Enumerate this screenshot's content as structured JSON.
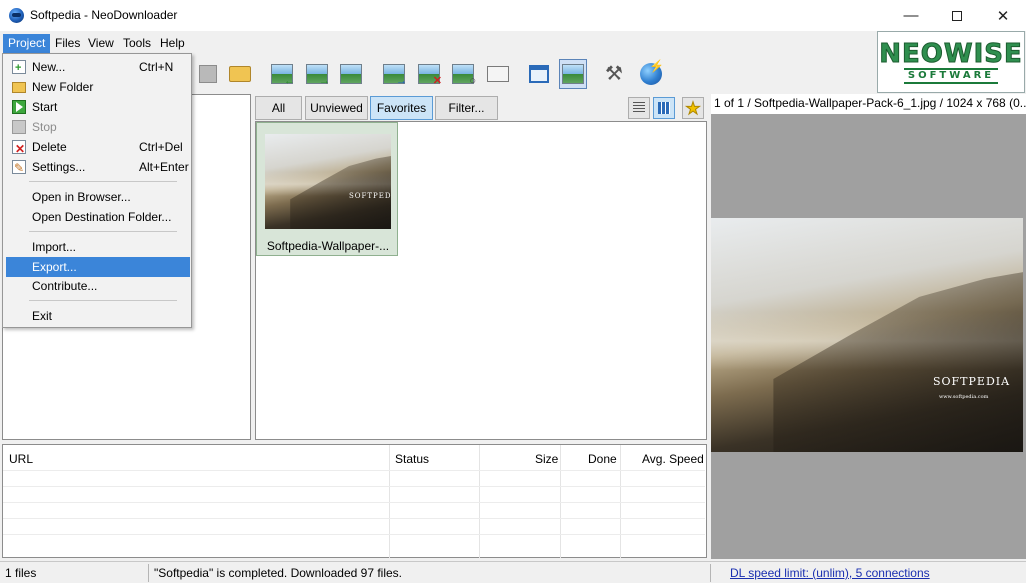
{
  "window": {
    "title": "Softpedia - NeoDownloader"
  },
  "menubar": {
    "items": [
      "Project",
      "Files",
      "View",
      "Tools",
      "Help"
    ]
  },
  "project_menu": {
    "items": [
      {
        "label": "New...",
        "shortcut": "Ctrl+N",
        "icon": "new-project-icon"
      },
      {
        "label": "New Folder",
        "shortcut": "",
        "icon": "folder-icon"
      },
      {
        "label": "Start",
        "shortcut": "",
        "icon": "start-icon"
      },
      {
        "label": "Stop",
        "shortcut": "",
        "icon": "stop-icon",
        "disabled": true
      },
      {
        "label": "Delete",
        "shortcut": "Ctrl+Del",
        "icon": "delete-icon"
      },
      {
        "label": "Settings...",
        "shortcut": "Alt+Enter",
        "icon": "settings-icon"
      },
      {
        "label": "Open in Browser..."
      },
      {
        "label": "Open Destination Folder..."
      },
      {
        "label": "Import..."
      },
      {
        "label": "Export...",
        "highlighted": true
      },
      {
        "label": "Contribute..."
      },
      {
        "label": "Exit"
      }
    ]
  },
  "logo": {
    "main": "NEOWISE",
    "sub": "SOFTWARE"
  },
  "filters": {
    "all": "All",
    "unviewed": "Unviewed",
    "favorites": "Favorites",
    "filter": "Filter..."
  },
  "thumbnail": {
    "label": "Softpedia-Wallpaper-...",
    "watermark": "SOFTPEDIA"
  },
  "preview": {
    "header": "1 of 1 / Softpedia-Wallpaper-Pack-6_1.jpg / 1024 x 768 (0....",
    "watermark": "SOFTPEDIA",
    "sub_watermark": "www.softpedia.com"
  },
  "transfers": {
    "columns": [
      "URL",
      "Status",
      "Size",
      "Done",
      "Avg. Speed"
    ]
  },
  "statusbar": {
    "files": "1 files",
    "message": "\"Softpedia\" is completed. Downloaded 97 files.",
    "speed_link": "DL speed limit: (unlim), 5 connections"
  },
  "colors": {
    "highlight": "#3b85d9",
    "link": "#1a2fb0",
    "logo_green": "#2f8f4f"
  }
}
